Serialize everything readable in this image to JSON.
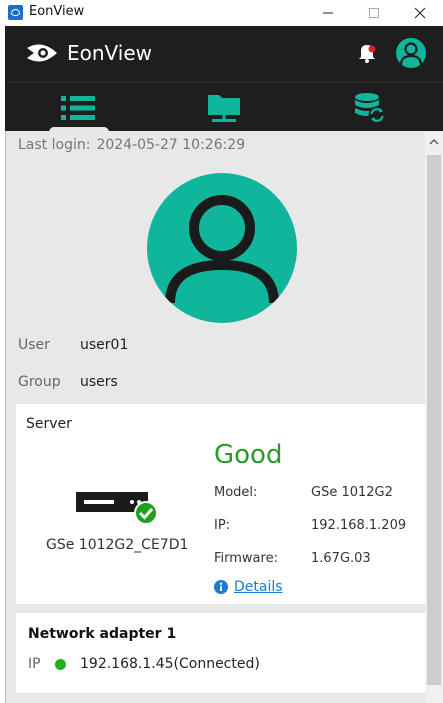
{
  "window": {
    "title": "EonView"
  },
  "header": {
    "brand": "EonView"
  },
  "tabs": [
    {
      "name": "list-icon"
    },
    {
      "name": "network-folder-icon"
    },
    {
      "name": "database-sync-icon"
    }
  ],
  "profile": {
    "last_login_label": "Last login:",
    "last_login_value": "2024-05-27 10:26:29",
    "user_label": "User",
    "user_value": "user01",
    "group_label": "Group",
    "group_value": "users"
  },
  "server": {
    "title": "Server",
    "device_name": "GSe 1012G2_CE7D1",
    "status": "Good",
    "model_label": "Model:",
    "model_value": "GSe 1012G2",
    "ip_label": "IP:",
    "ip_value": "192.168.1.209",
    "firmware_label": "Firmware:",
    "firmware_value": "1.67G.03",
    "details_link": "Details"
  },
  "network": {
    "title": "Network adapter 1",
    "ip_label": "IP",
    "ip_value": "192.168.1.45(Connected)",
    "status_color": "#1fb01f"
  },
  "colors": {
    "accent": "#0fb69b",
    "header_bg": "#1e1e1e",
    "good": "#2b9a2b",
    "link": "#1a7bd6"
  }
}
